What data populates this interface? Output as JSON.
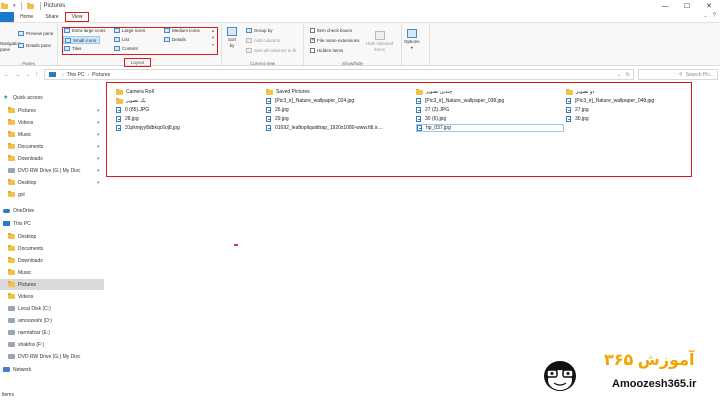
{
  "window": {
    "title": "Pictures",
    "minimize": "—",
    "maximize": "☐",
    "close": "✕"
  },
  "menu": {
    "tabs": [
      "Home",
      "Share",
      "View"
    ],
    "active": "View"
  },
  "ribbon": {
    "panes": {
      "label": "Panes",
      "navigation_pane": "Navigation\npane",
      "preview_pane": "Preview pane",
      "details_pane": "Details pane"
    },
    "layout": {
      "label": "Layout",
      "options": [
        "Extra large icons",
        "Large icons",
        "Medium icons",
        "Small icons",
        "List",
        "Details",
        "Tiles",
        "Content"
      ],
      "selected": "Small icons"
    },
    "current_view": {
      "label": "Current view",
      "sort_by": "Sort\nby",
      "group_by": "Group by",
      "add_columns": "Add columns",
      "size_all_columns": "Size all columns to fit"
    },
    "show_hide": {
      "label": "Show/hide",
      "item_check_boxes": "Item check boxes",
      "file_name_extensions": "File name extensions",
      "hidden_items": "Hidden items",
      "hide_selected_items": "Hide selected\nitems",
      "checked": {
        "item_check_boxes": false,
        "file_name_extensions": true,
        "hidden_items": false
      }
    },
    "options": {
      "label": "Options"
    }
  },
  "address": {
    "path": [
      "This PC",
      "Pictures"
    ],
    "search_placeholder": "Search Pic..."
  },
  "sidebar": {
    "items": [
      {
        "label": "Quick access",
        "icon": "star-icon",
        "pinned": false
      },
      {
        "label": "Pictures",
        "icon": "folder-icon",
        "pinned": true
      },
      {
        "label": "Videos",
        "icon": "folder-icon",
        "pinned": true
      },
      {
        "label": "Music",
        "icon": "folder-icon",
        "pinned": true
      },
      {
        "label": "Documents",
        "icon": "folder-icon",
        "pinned": true
      },
      {
        "label": "Downloads",
        "icon": "folder-icon",
        "pinned": true
      },
      {
        "label": "DVD RW Drive (G:) My Disc",
        "icon": "drive-icon",
        "pinned": true
      },
      {
        "label": "Desktop",
        "icon": "folder-icon",
        "pinned": true
      },
      {
        "label": "gol",
        "icon": "folder-icon",
        "pinned": false
      },
      {
        "label": "OneDrive",
        "icon": "cloud-icon",
        "pinned": false
      },
      {
        "label": "This PC",
        "icon": "computer-icon",
        "pinned": false
      },
      {
        "label": "Desktop",
        "icon": "folder-icon",
        "pinned": false
      },
      {
        "label": "Documents",
        "icon": "folder-icon",
        "pinned": false
      },
      {
        "label": "Downloads",
        "icon": "folder-icon",
        "pinned": false
      },
      {
        "label": "Music",
        "icon": "folder-icon",
        "pinned": false
      },
      {
        "label": "Pictures",
        "icon": "folder-icon",
        "pinned": false,
        "selected": true
      },
      {
        "label": "Videos",
        "icon": "folder-icon",
        "pinned": false
      },
      {
        "label": "Local Disk (C:)",
        "icon": "drive-icon",
        "pinned": false
      },
      {
        "label": "amoozeshi (D:)",
        "icon": "drive-icon",
        "pinned": false
      },
      {
        "label": "narmafzar (E:)",
        "icon": "drive-icon",
        "pinned": false
      },
      {
        "label": "shakhsi (F:)",
        "icon": "drive-icon",
        "pinned": false
      },
      {
        "label": "DVD RW Drive (G:) My Disc",
        "icon": "drive-icon",
        "pinned": false
      },
      {
        "label": "Network",
        "icon": "network-icon",
        "pinned": false
      }
    ]
  },
  "files": [
    {
      "name": "Camera Roll",
      "type": "folder"
    },
    {
      "name": "Saved Pictures",
      "type": "folder"
    },
    {
      "name": "چندین تصویر",
      "type": "folder"
    },
    {
      "name": "دو تصویر",
      "type": "folder"
    },
    {
      "name": "یک تصویر",
      "type": "folder"
    },
    {
      "name": "[Pic3_ir]_Nature_wallpaper_024.jpg",
      "type": "image"
    },
    {
      "name": "[Pic3_ir]_Nature_wallpaper_038.jpg",
      "type": "image"
    },
    {
      "name": "[Pic3_ir]_Nature_wallpaper_048.jpg",
      "type": "image"
    },
    {
      "name": "0 (85).JPG",
      "type": "image"
    },
    {
      "name": "26.jpg",
      "type": "image"
    },
    {
      "name": "27 (2).JPG",
      "type": "image"
    },
    {
      "name": "27.jpg",
      "type": "image"
    },
    {
      "name": "28.jpg",
      "type": "image"
    },
    {
      "name": "29.jpg",
      "type": "image"
    },
    {
      "name": "30 (6).jpg",
      "type": "image"
    },
    {
      "name": "30.jpg",
      "type": "image"
    },
    {
      "name": "31pkmjyy8dbkqc6oj8.jpg",
      "type": "image"
    },
    {
      "name": "01692_leaftopliquidtrap_1920x1080-www.fdl.ir....",
      "type": "image"
    },
    {
      "name": "hp_037.jpg",
      "type": "image",
      "selected": true
    }
  ],
  "status": {
    "text": "items"
  },
  "watermark": {
    "persian": "آموزش ۳۶۵",
    "site": "Amoozesh365.ir"
  },
  "colors": {
    "accent": "#1979ca",
    "highlight_box": "#d81b1b",
    "folder": "#f0c24b",
    "logo_orange": "#f4a300"
  }
}
